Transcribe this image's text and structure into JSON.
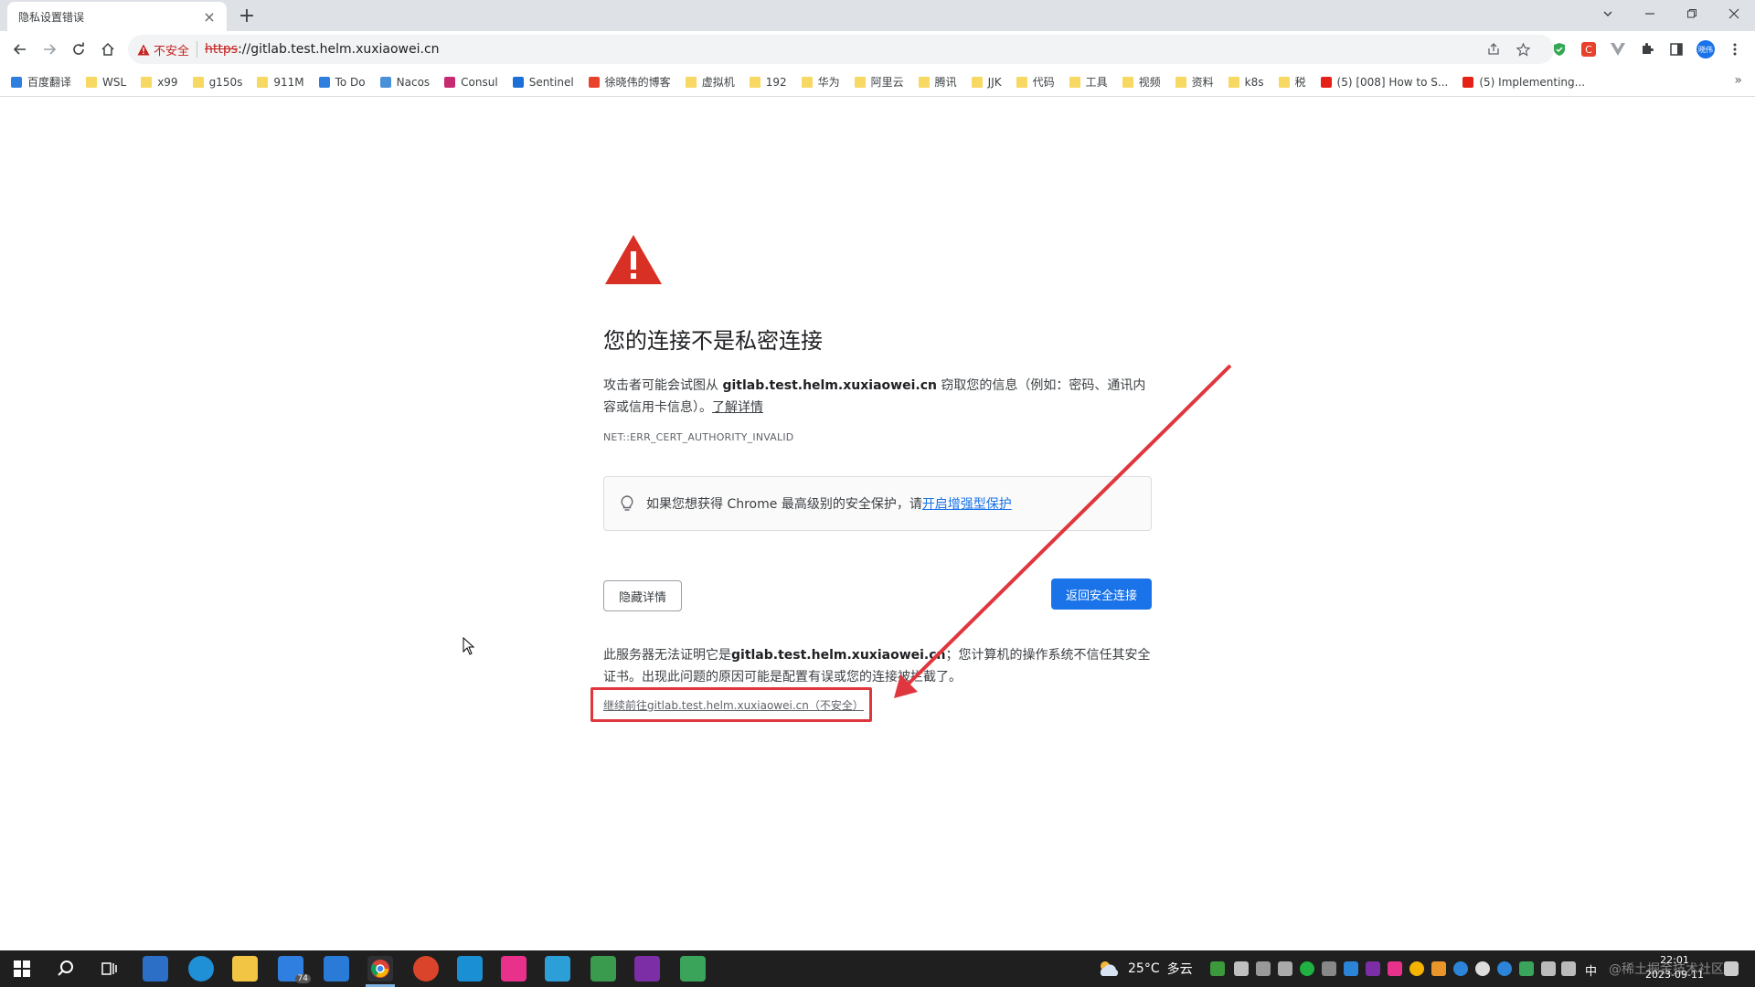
{
  "window": {
    "tab_title": "隐私设置错误",
    "tab_close": "×",
    "new_tab": "+"
  },
  "toolbar": {
    "security_label": "不安全",
    "url_scheme": "https",
    "url_rest": "://gitlab.test.helm.xuxiaowei.cn",
    "profile_label": "晓伟"
  },
  "bookmarks": [
    {
      "label": "百度翻译",
      "icon": "translate-icon"
    },
    {
      "label": "WSL",
      "icon": "folder-icon"
    },
    {
      "label": "x99",
      "icon": "folder-icon"
    },
    {
      "label": "g150s",
      "icon": "folder-icon"
    },
    {
      "label": "911M",
      "icon": "folder-icon"
    },
    {
      "label": "To Do",
      "icon": "todo-icon"
    },
    {
      "label": "Nacos",
      "icon": "nacos-icon"
    },
    {
      "label": "Consul",
      "icon": "consul-icon"
    },
    {
      "label": "Sentinel",
      "icon": "sentinel-icon"
    },
    {
      "label": "徐晓伟的博客",
      "icon": "blog-icon"
    },
    {
      "label": "虚拟机",
      "icon": "folder-icon"
    },
    {
      "label": "192",
      "icon": "folder-icon"
    },
    {
      "label": "华为",
      "icon": "folder-icon"
    },
    {
      "label": "阿里云",
      "icon": "folder-icon"
    },
    {
      "label": "腾讯",
      "icon": "folder-icon"
    },
    {
      "label": "JJK",
      "icon": "folder-icon"
    },
    {
      "label": "代码",
      "icon": "folder-icon"
    },
    {
      "label": "工具",
      "icon": "folder-icon"
    },
    {
      "label": "视频",
      "icon": "folder-icon"
    },
    {
      "label": "资料",
      "icon": "folder-icon"
    },
    {
      "label": "k8s",
      "icon": "folder-icon"
    },
    {
      "label": "税",
      "icon": "folder-icon"
    },
    {
      "label": "(5) [008] How to S...",
      "icon": "youtube-icon"
    },
    {
      "label": "(5) Implementing...",
      "icon": "youtube-icon"
    }
  ],
  "bookmarks_more": "»",
  "page": {
    "heading": "您的连接不是私密连接",
    "desc_before": "攻击者可能会试图从 ",
    "desc_host": "gitlab.test.helm.xuxiaowei.cn",
    "desc_after": " 窃取您的信息（例如：密码、通讯内容或信用卡信息）。",
    "learn_more": "了解详情",
    "error_code": "NET::ERR_CERT_AUTHORITY_INVALID",
    "enhanced_before": "如果您想获得 Chrome 最高级别的安全保护，请",
    "enhanced_link": "开启增强型保护",
    "hide_details": "隐藏详情",
    "back_to_safety": "返回安全连接",
    "detail_before": "此服务器无法证明它是",
    "detail_host": "gitlab.test.helm.xuxiaowei.cn",
    "detail_after": "；您计算机的操作系统不信任其安全证书。出现此问题的原因可能是配置有误或您的连接被拦截了。",
    "proceed_link": "继续前往gitlab.test.helm.xuxiaowei.cn（不安全）"
  },
  "taskbar": {
    "weather_temp": "25°C",
    "weather_desc": "多云",
    "badge_count": "74",
    "ime": "中",
    "time": "22:01",
    "date": "2023-09-11",
    "watermark": "@稀土掘金技术社区"
  },
  "colors": {
    "danger": "#c5221f",
    "primary": "#1a73e8",
    "annotation": "#e0373f"
  }
}
